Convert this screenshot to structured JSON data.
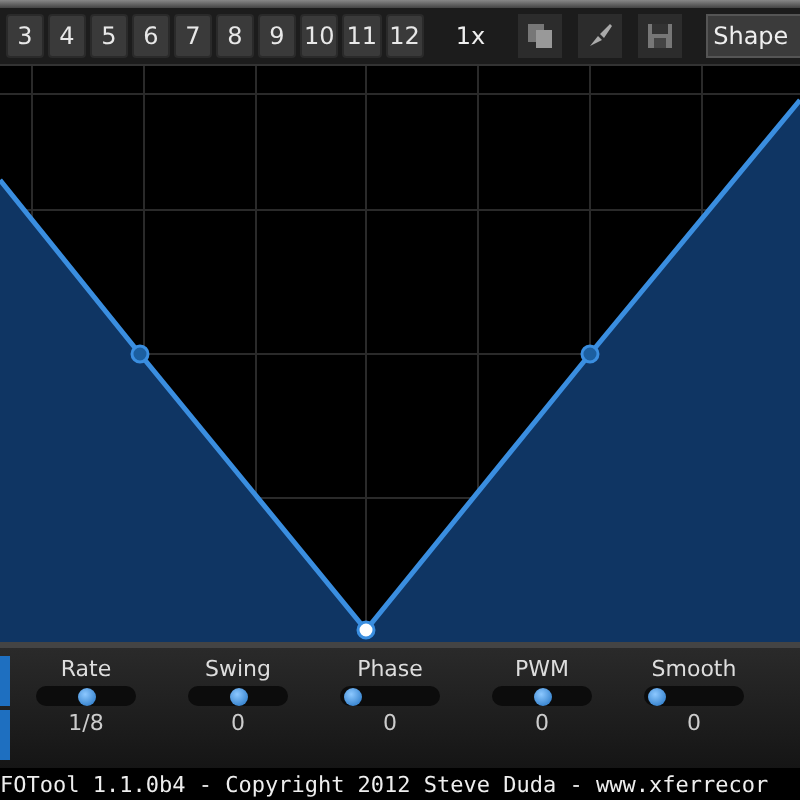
{
  "toolbar": {
    "tabs": [
      {
        "label": "3",
        "selected": false
      },
      {
        "label": "4",
        "selected": false
      },
      {
        "label": "5",
        "selected": false
      },
      {
        "label": "6",
        "selected": false
      },
      {
        "label": "7",
        "selected": false
      },
      {
        "label": "8",
        "selected": false
      },
      {
        "label": "9",
        "selected": false
      },
      {
        "label": "10",
        "selected": false
      },
      {
        "label": "11",
        "selected": false
      },
      {
        "label": "12",
        "selected": false
      }
    ],
    "zoom": "1x",
    "shape_button": "Shape"
  },
  "controls": [
    {
      "label": "Rate",
      "level": 0.5,
      "reading": "1/8"
    },
    {
      "label": "Swing",
      "level": 0.5,
      "reading": "0"
    },
    {
      "label": "Phase",
      "level": 0.05,
      "reading": "0"
    },
    {
      "label": "PWM",
      "level": 0.5,
      "reading": "0"
    },
    {
      "label": "Smooth",
      "level": 0.05,
      "reading": "0"
    }
  ],
  "status_bar": "FOTool 1.1.0b4 - Copyright 2012 Steve Duda - www.xferrecor"
}
